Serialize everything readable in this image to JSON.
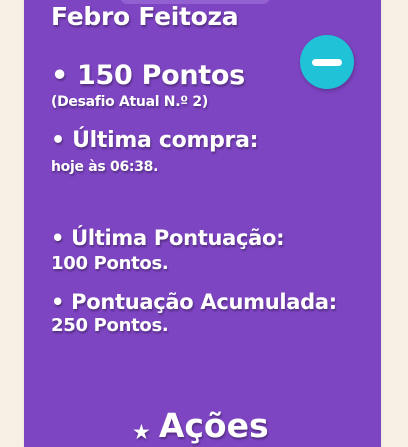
{
  "profile": {
    "name": "Febro Feitoza",
    "points": "• 150 Pontos",
    "challenge": "(Desafio Atual N.º 2)"
  },
  "last_purchase": {
    "title": "• Última compra:",
    "value": "hoje às 06:38."
  },
  "last_score": {
    "title": "• Última Pontuação:",
    "value": "100 Pontos."
  },
  "total_score": {
    "title": "• Pontuação Acumulada:",
    "value": "250 Pontos."
  },
  "actions": {
    "icon": "star-icon",
    "label": "Ações"
  },
  "collapse_button": {
    "icon": "minus-icon"
  },
  "colors": {
    "background": "#f6f0e4",
    "card": "#7e45c3",
    "accent": "#1fc2d7",
    "text": "#ffffff"
  }
}
